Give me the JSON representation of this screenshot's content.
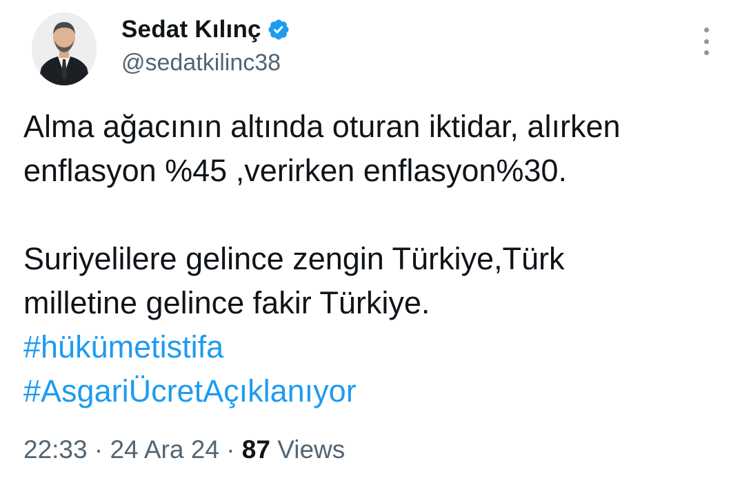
{
  "author": {
    "display_name": "Sedat Kılınç",
    "handle": "@sedatkilinc38",
    "verified": true,
    "verified_color": "#1d9bf0"
  },
  "tweet": {
    "paragraph1": [
      "Alma ağacının altında oturan iktidar, alırken",
      "enflasyon %45 ,verirken enflasyon%30."
    ],
    "paragraph2": [
      "Suriyelilere gelince zengin Türkiye,Türk",
      "milletine gelince fakir Türkiye."
    ],
    "hashtags": [
      "#hükümetistifa",
      "#AsgariÜcretAçıklanıyor"
    ],
    "time": "22:33",
    "separator": "·",
    "date": "24 Ara 24",
    "views_count": "87",
    "views_label": "Views"
  },
  "colors": {
    "link": "#1d9bf0",
    "text": "#0f1419",
    "secondary": "#536471"
  },
  "icons": {
    "verified": "verified-badge-icon",
    "more": "more-options-icon"
  }
}
